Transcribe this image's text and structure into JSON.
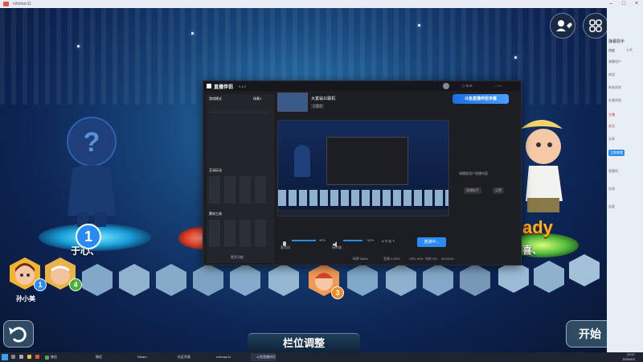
{
  "window": {
    "title": "rcfxman11"
  },
  "game": {
    "left_slot_number": "1",
    "left_slot_name": "于心、",
    "right_slot_text": "ady",
    "right_slot_name": "喜、",
    "player_name": "孙小美",
    "player_badge": "1",
    "second_badge": "4",
    "third_badge": "3",
    "bottom_label": "栏位调整",
    "start_label": "开始"
  },
  "app": {
    "name": "直播伴侣",
    "version": "9.4.2",
    "mode_label": "游戏模式",
    "scene_tab": "场景1",
    "live_room": "大富翁11联机",
    "live_tag": "大富翁",
    "banner_text": "斗鱼直播伴侣专属",
    "interactive_title": "互动玩法",
    "material_title": "素材工具",
    "more_label": "更多功能",
    "side_text": "请播放用户直播内容",
    "side_btn_a": "直播助手",
    "side_btn_b": "设置",
    "mic_label": "麦克风",
    "mic_pct": "99%",
    "speaker_label": "扬声器",
    "speaker_pct": "54%",
    "start_live": "连接中...",
    "stats": [
      "码率 0kb/s",
      "丢帧 0.00%",
      "CPU 30%",
      "内存 0%",
      "00:00:00"
    ]
  },
  "sidebar": {
    "title": "弹幕助手",
    "tabs": [
      "热度",
      "人气"
    ],
    "lines": [
      "弹幕用户",
      "欢迎",
      "系统消息",
      "礼物消息",
      "主播",
      "关注",
      "分享",
      "直播间",
      "在线",
      "连麦"
    ],
    "button": "立即查看"
  },
  "taskbar": {
    "items": [
      "微信",
      "微信",
      "Steam",
      "社区列表",
      "rcfxman11",
      "斗鱼直播伴侣"
    ],
    "time": "22:57",
    "date": "2025/8/3"
  },
  "colors": {
    "accent_blue": "#2a8bf2",
    "accent_orange": "#f08a24",
    "app_bg": "#1c1e24"
  }
}
